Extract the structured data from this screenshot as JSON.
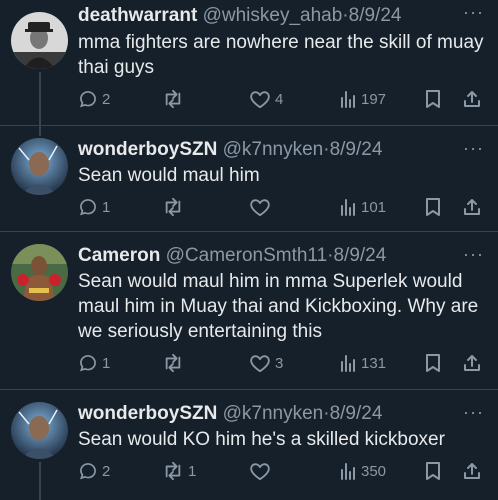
{
  "tweets": [
    {
      "name": "deathwarrant",
      "handle": "@whiskey_ahab",
      "date": "8/9/24",
      "text": "mma fighters are nowhere near the skill of muay thai guys",
      "replies": "2",
      "retweets": "",
      "likes": "4",
      "views": "197"
    },
    {
      "name": "wonderboySZN",
      "handle": "@k7nnyken",
      "date": "8/9/24",
      "text": "Sean would maul him",
      "replies": "1",
      "retweets": "",
      "likes": "",
      "views": "101"
    },
    {
      "name": "Cameron",
      "handle": "@CameronSmth11",
      "date": "8/9/24",
      "text": "Sean would maul him in mma Superlek would maul him in Muay thai and Kickboxing. Why are we seriously entertaining this",
      "replies": "1",
      "retweets": "",
      "likes": "3",
      "views": "131"
    },
    {
      "name": "wonderboySZN",
      "handle": "@k7nnyken",
      "date": "8/9/24",
      "text": "Sean would KO him he's a skilled kickboxer",
      "replies": "2",
      "retweets": "1",
      "likes": "",
      "views": "350"
    }
  ],
  "separator": "·",
  "more_glyph": "···",
  "colors": {
    "background": "#15202b",
    "primary_text": "#e7e9ea",
    "secondary_text": "#8b98a5",
    "divider": "#38444d"
  }
}
